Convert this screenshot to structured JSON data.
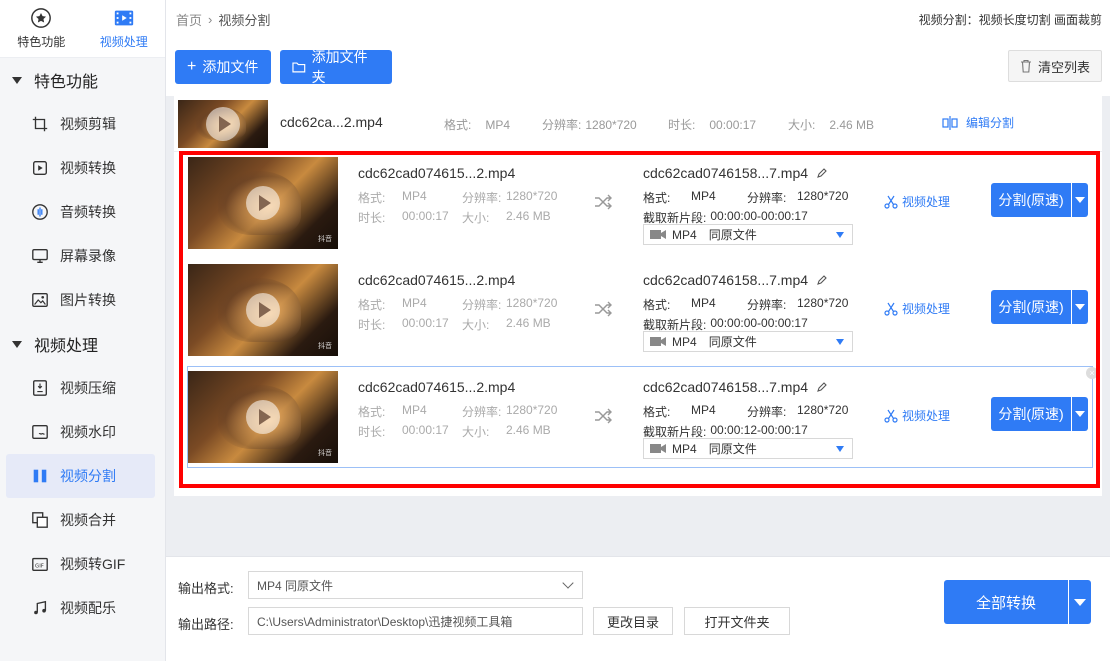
{
  "sidebar": {
    "tabs": [
      {
        "label": "特色功能",
        "icon": "star-icon"
      },
      {
        "label": "视频处理",
        "icon": "film-icon"
      }
    ],
    "groups": [
      {
        "label": "特色功能"
      },
      {
        "label": "视频处理"
      }
    ],
    "items": [
      {
        "label": "视频剪辑"
      },
      {
        "label": "视频转换"
      },
      {
        "label": "音频转换"
      },
      {
        "label": "屏幕录像"
      },
      {
        "label": "图片转换"
      },
      {
        "label": "视频压缩"
      },
      {
        "label": "视频水印"
      },
      {
        "label": "视频分割"
      },
      {
        "label": "视频合并"
      },
      {
        "label": "视频转GIF"
      },
      {
        "label": "视频配乐"
      }
    ]
  },
  "header": {
    "breadcrumb_home": "首页",
    "breadcrumb_sep": "›",
    "breadcrumb_current": "视频分割",
    "hint": "视频分割：视频长度切割 画面裁剪"
  },
  "toolbar": {
    "add_file": "添加文件",
    "add_folder": "添加文件夹",
    "clear_list": "清空列表"
  },
  "parent": {
    "name": "cdc62ca...2.mp4",
    "format_label": "格式:",
    "format": "MP4",
    "resolution_label": "分辨率:",
    "resolution": "1280*720",
    "duration_label": "时长:",
    "duration": "00:00:17",
    "size_label": "大小:",
    "size": "2.46 MB",
    "edit_label": "编辑分割"
  },
  "segments": [
    {
      "name": "cdc62cad074615...2.mp4",
      "format_label": "格式:",
      "format": "MP4",
      "resolution_label": "分辨率:",
      "resolution": "1280*720",
      "duration_label": "时长:",
      "duration": "00:00:17",
      "size_label": "大小:",
      "size": "2.46 MB",
      "out_name": "cdc62cad0746158...7.mp4",
      "out_format_label": "格式:",
      "out_format": "MP4",
      "out_resolution_label": "分辨率:",
      "out_resolution": "1280*720",
      "clip_label": "截取新片段:",
      "clip": "00:00:00-00:00:17",
      "out_select": "MP4",
      "out_select_note": "同原文件",
      "process_label": "视频处理",
      "split_label": "分割(原速)"
    },
    {
      "name": "cdc62cad074615...2.mp4",
      "format_label": "格式:",
      "format": "MP4",
      "resolution_label": "分辨率:",
      "resolution": "1280*720",
      "duration_label": "时长:",
      "duration": "00:00:17",
      "size_label": "大小:",
      "size": "2.46 MB",
      "out_name": "cdc62cad0746158...7.mp4",
      "out_format_label": "格式:",
      "out_format": "MP4",
      "out_resolution_label": "分辨率:",
      "out_resolution": "1280*720",
      "clip_label": "截取新片段:",
      "clip": "00:00:00-00:00:17",
      "out_select": "MP4",
      "out_select_note": "同原文件",
      "process_label": "视频处理",
      "split_label": "分割(原速)"
    },
    {
      "name": "cdc62cad074615...2.mp4",
      "format_label": "格式:",
      "format": "MP4",
      "resolution_label": "分辨率:",
      "resolution": "1280*720",
      "duration_label": "时长:",
      "duration": "00:00:17",
      "size_label": "大小:",
      "size": "2.46 MB",
      "out_name": "cdc62cad0746158...7.mp4",
      "out_format_label": "格式:",
      "out_format": "MP4",
      "out_resolution_label": "分辨率:",
      "out_resolution": "1280*720",
      "clip_label": "截取新片段:",
      "clip": "00:00:12-00:00:17",
      "out_select": "MP4",
      "out_select_note": "同原文件",
      "process_label": "视频处理",
      "split_label": "分割(原速)"
    }
  ],
  "bottom": {
    "format_label": "输出格式:",
    "format_value": "MP4  同原文件",
    "path_label": "输出路径:",
    "path_value": "C:\\Users\\Administrator\\Desktop\\迅捷视频工具箱",
    "change_dir": "更改目录",
    "open_folder": "打开文件夹",
    "convert_all": "全部转换"
  },
  "thumb_tag": "抖音",
  "colors": {
    "accent": "#2f7bf5",
    "highlight": "#ff0000"
  }
}
